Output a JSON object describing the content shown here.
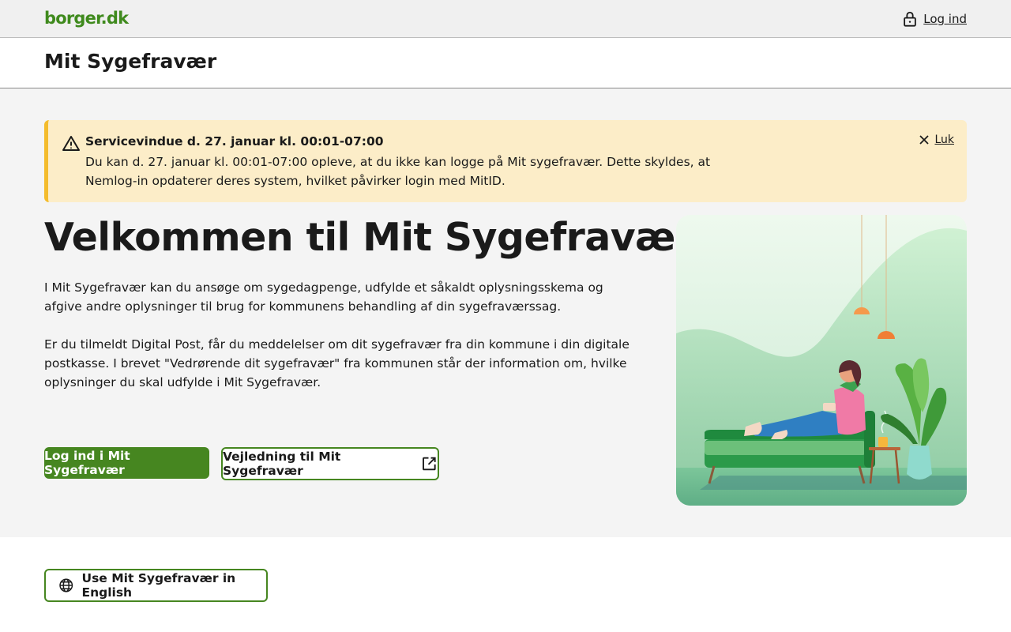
{
  "header": {
    "logo_text": "borger.dk",
    "login_label": "Log ind",
    "brand_color": "#3f8a1d"
  },
  "app": {
    "title": "Mit Sygefravær"
  },
  "alert": {
    "title": "Servicevindue d. 27. januar kl. 00:01-07:00",
    "body": "Du kan d. 27. januar kl. 00:01-07:00 opleve, at du ikke kan logge på Mit sygefravær. Dette skyldes, at Nemlog-in opdaterer deres system, hvilket påvirker login med MitID.",
    "close_label": "Luk",
    "icon": "warning-icon",
    "background": "#fcedc8",
    "accent": "#f4bc2c"
  },
  "main": {
    "heading": "Velkommen til Mit Sygefravær",
    "paragraph1": "I Mit Sygefravær kan du ansøge om sygedagpenge, udfylde et såkaldt oplysningsskema og afgive andre oplysninger til brug for kommunens behandling af din sygefraværssag.",
    "paragraph2": "Er du tilmeldt Digital Post, får du meddelelser om dit sygefravær fra din kommune i din digitale postkasse. I brevet \"Vedrørende dit sygefravær\" fra kommunen står der information om, hvilke oplysninger du skal udfylde i Mit Sygefravær.",
    "primary_button": "Log ind i Mit Sygefravær",
    "secondary_button": "Vejledning til Mit Sygefravær",
    "button_color": "#468620"
  },
  "footer": {
    "language_button": "Use Mit Sygefravær in English",
    "icon": "globe-icon"
  }
}
